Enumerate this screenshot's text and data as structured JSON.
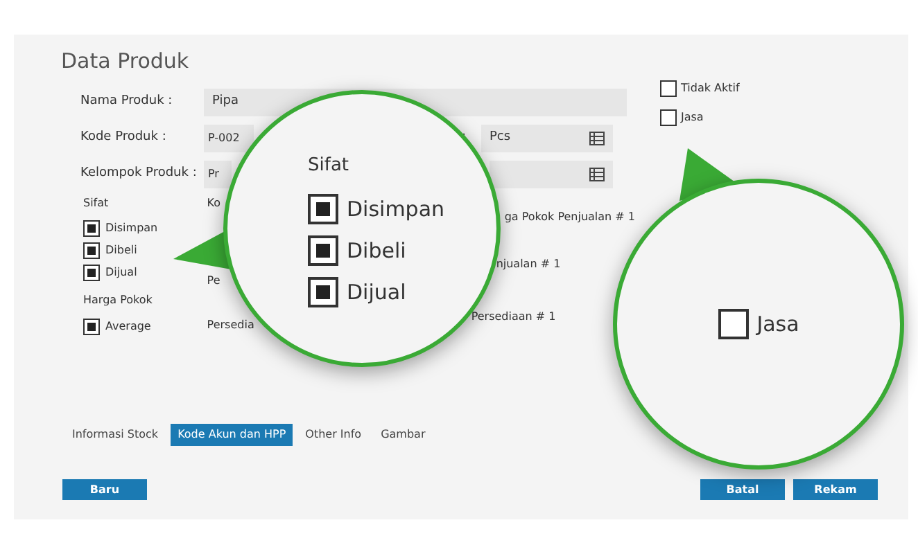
{
  "title": "Data Produk",
  "fields": [
    {
      "label": "Nama Produk :",
      "value": "Pipa"
    },
    {
      "label": "Kode Produk :",
      "value": "P-002"
    },
    {
      "label": "Kelompok Produk :",
      "value": "Pr"
    }
  ],
  "unit_field": {
    "label": ":",
    "value": "Pcs"
  },
  "flags": [
    {
      "label": "Tidak Aktif",
      "checked": false
    },
    {
      "label": "Jasa",
      "checked": false
    }
  ],
  "sifat": {
    "label": "Sifat",
    "options": [
      {
        "label": "Disimpan",
        "checked": true
      },
      {
        "label": "Dibeli",
        "checked": true
      },
      {
        "label": "Dijual",
        "checked": true
      }
    ]
  },
  "harga_pokok": {
    "label": "Harga Pokok",
    "options": [
      {
        "label": "Average",
        "checked": true
      }
    ]
  },
  "column_2": [
    "Ko",
    "Pe",
    "Persedia"
  ],
  "column_3": [
    "ga Pokok Penjualan # 1",
    "njualan # 1",
    "Persediaan # 1"
  ],
  "tabs": [
    {
      "label": "Informasi Stock",
      "selected": false
    },
    {
      "label": "Kode Akun dan HPP",
      "selected": true
    },
    {
      "label": "Other Info",
      "selected": false
    },
    {
      "label": "Gambar",
      "selected": false
    }
  ],
  "buttons_left": [
    "Baru"
  ],
  "buttons_right": [
    "Batal",
    "Rekam"
  ],
  "magnifiers": [
    {
      "heading": "Sifat",
      "options": [
        {
          "label": "Disimpan",
          "checked": true
        },
        {
          "label": "Dibeli",
          "checked": true
        },
        {
          "label": "Dijual",
          "checked": true
        }
      ]
    },
    {
      "options": [
        {
          "label": "Jasa",
          "checked": false
        }
      ]
    }
  ]
}
